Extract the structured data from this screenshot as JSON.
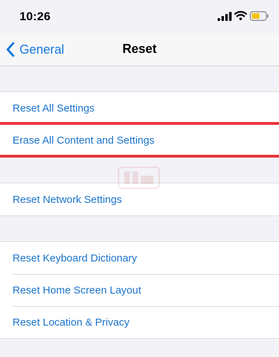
{
  "status_bar": {
    "time": "10:26",
    "icons": [
      "cellular-signal-icon",
      "wifi-icon",
      "battery-icon"
    ],
    "battery_color": "#f5c518"
  },
  "nav": {
    "back_label": "General",
    "title": "Reset",
    "accent": "#1478de"
  },
  "groups": [
    {
      "items": [
        {
          "label": "Reset All Settings"
        },
        {
          "label": "Erase All Content and Settings",
          "highlighted": true
        }
      ]
    },
    {
      "items": [
        {
          "label": "Reset Network Settings"
        }
      ]
    },
    {
      "items": [
        {
          "label": "Reset Keyboard Dictionary"
        },
        {
          "label": "Reset Home Screen Layout"
        },
        {
          "label": "Reset Location & Privacy"
        }
      ]
    }
  ],
  "colors": {
    "highlight": "#e9343a",
    "row_text": "#1a73c9",
    "background": "#f2f2f7"
  }
}
